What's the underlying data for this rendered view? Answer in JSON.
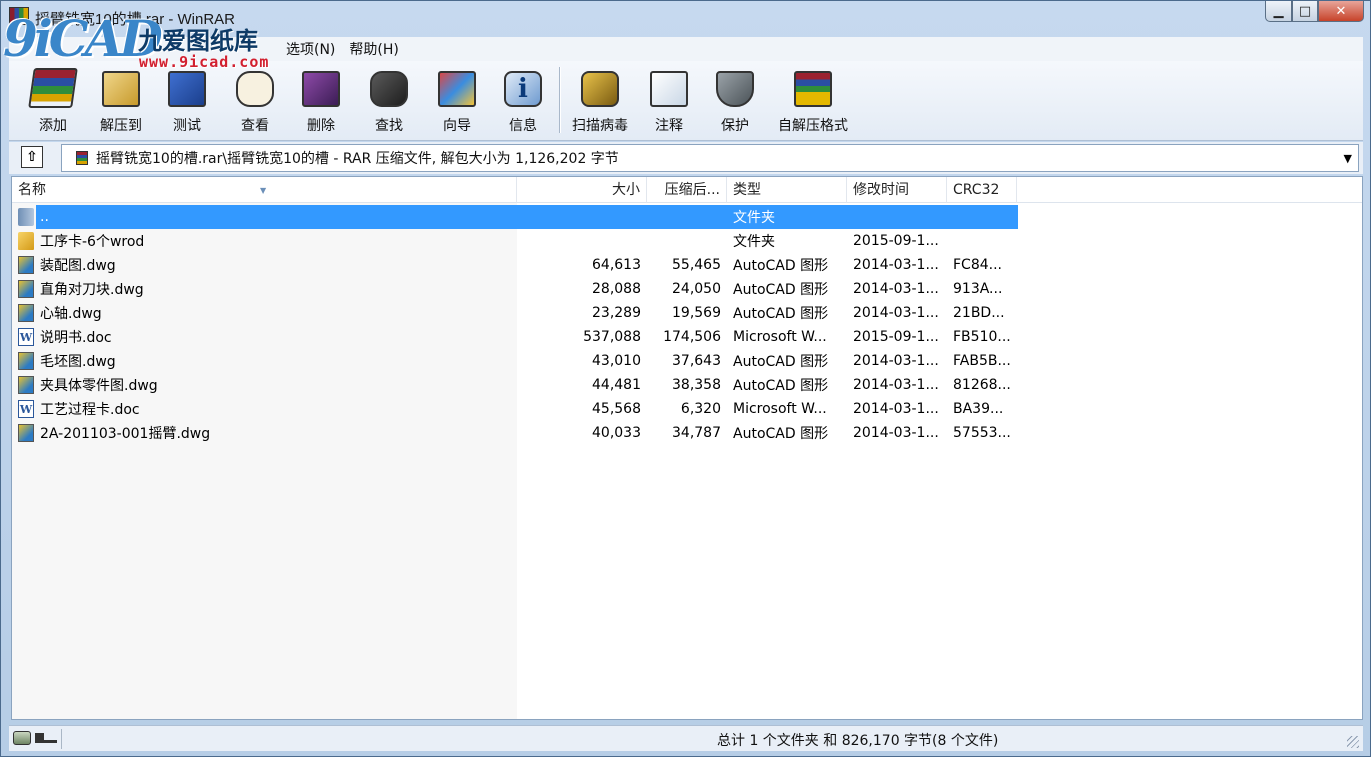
{
  "window": {
    "title": "摇臂铣宽10的槽.rar - WinRAR"
  },
  "watermark": {
    "mark": "9iCAD",
    "name": "九爱图纸库",
    "url": "www.9icad.com"
  },
  "menu": {
    "items": [
      "选项(N)",
      "帮助(H)"
    ]
  },
  "toolbar": {
    "add": "添加",
    "extract": "解压到",
    "test": "测试",
    "view": "查看",
    "delete": "删除",
    "find": "查找",
    "wizard": "向导",
    "info": "信息",
    "scan": "扫描病毒",
    "comment": "注释",
    "protect": "保护",
    "sfx": "自解压格式"
  },
  "address": {
    "path": "摇臂铣宽10的槽.rar\\摇臂铣宽10的槽 - RAR 压缩文件, 解包大小为 1,126,202 字节"
  },
  "columns": {
    "name": "名称",
    "size": "大小",
    "packed": "压缩后...",
    "type": "类型",
    "modified": "修改时间",
    "crc": "CRC32"
  },
  "files": [
    {
      "name": "..",
      "size": "",
      "packed": "",
      "type": "文件夹",
      "modified": "",
      "crc": "",
      "icon": "up-folder-icon"
    },
    {
      "name": "工序卡-6个wrod",
      "size": "",
      "packed": "",
      "type": "文件夹",
      "modified": "2015-09-1...",
      "crc": "",
      "icon": "folder-icon"
    },
    {
      "name": "装配图.dwg",
      "size": "64,613",
      "packed": "55,465",
      "type": "AutoCAD 图形",
      "modified": "2014-03-1...",
      "crc": "FC84...",
      "icon": "dwg-file-icon"
    },
    {
      "name": "直角对刀块.dwg",
      "size": "28,088",
      "packed": "24,050",
      "type": "AutoCAD 图形",
      "modified": "2014-03-1...",
      "crc": "913A...",
      "icon": "dwg-file-icon"
    },
    {
      "name": "心轴.dwg",
      "size": "23,289",
      "packed": "19,569",
      "type": "AutoCAD 图形",
      "modified": "2014-03-1...",
      "crc": "21BD...",
      "icon": "dwg-file-icon"
    },
    {
      "name": "说明书.doc",
      "size": "537,088",
      "packed": "174,506",
      "type": "Microsoft W...",
      "modified": "2015-09-1...",
      "crc": "FB510...",
      "icon": "word-file-icon"
    },
    {
      "name": "毛坯图.dwg",
      "size": "43,010",
      "packed": "37,643",
      "type": "AutoCAD 图形",
      "modified": "2014-03-1...",
      "crc": "FAB5B...",
      "icon": "dwg-file-icon"
    },
    {
      "name": "夹具体零件图.dwg",
      "size": "44,481",
      "packed": "38,358",
      "type": "AutoCAD 图形",
      "modified": "2014-03-1...",
      "crc": "81268...",
      "icon": "dwg-file-icon"
    },
    {
      "name": "工艺过程卡.doc",
      "size": "45,568",
      "packed": "6,320",
      "type": "Microsoft W...",
      "modified": "2014-03-1...",
      "crc": "BA39...",
      "icon": "word-file-icon"
    },
    {
      "name": "2A-201103-001摇臂.dwg",
      "size": "40,033",
      "packed": "34,787",
      "type": "AutoCAD 图形",
      "modified": "2014-03-1...",
      "crc": "57553...",
      "icon": "dwg-file-icon"
    }
  ],
  "status": {
    "summary": "总计 1 个文件夹 和 826,170 字节(8 个文件)"
  },
  "colors": {
    "selection": "#3399ff",
    "frame": "#b9d1ea"
  }
}
